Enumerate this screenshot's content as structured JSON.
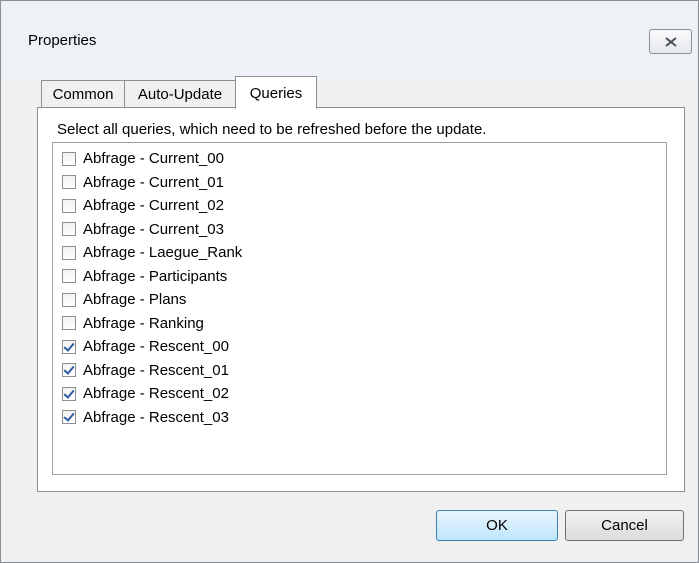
{
  "window": {
    "title": "Properties",
    "close_icon": "close-icon"
  },
  "tabs": [
    {
      "label": "Common",
      "selected": false
    },
    {
      "label": "Auto-Update",
      "selected": false
    },
    {
      "label": "Queries",
      "selected": true
    }
  ],
  "queries_tab": {
    "instructions": "Select all queries, which need to be refreshed before the update.",
    "items": [
      {
        "label": "Abfrage - Current_00",
        "checked": false
      },
      {
        "label": "Abfrage - Current_01",
        "checked": false
      },
      {
        "label": "Abfrage - Current_02",
        "checked": false
      },
      {
        "label": "Abfrage - Current_03",
        "checked": false
      },
      {
        "label": "Abfrage - Laegue_Rank",
        "checked": false
      },
      {
        "label": "Abfrage - Participants",
        "checked": false
      },
      {
        "label": "Abfrage - Plans",
        "checked": false
      },
      {
        "label": "Abfrage - Ranking",
        "checked": false
      },
      {
        "label": "Abfrage - Rescent_00",
        "checked": true
      },
      {
        "label": "Abfrage - Rescent_01",
        "checked": true
      },
      {
        "label": "Abfrage - Rescent_02",
        "checked": true
      },
      {
        "label": "Abfrage - Rescent_03",
        "checked": true
      }
    ]
  },
  "buttons": {
    "ok": "OK",
    "cancel": "Cancel"
  }
}
